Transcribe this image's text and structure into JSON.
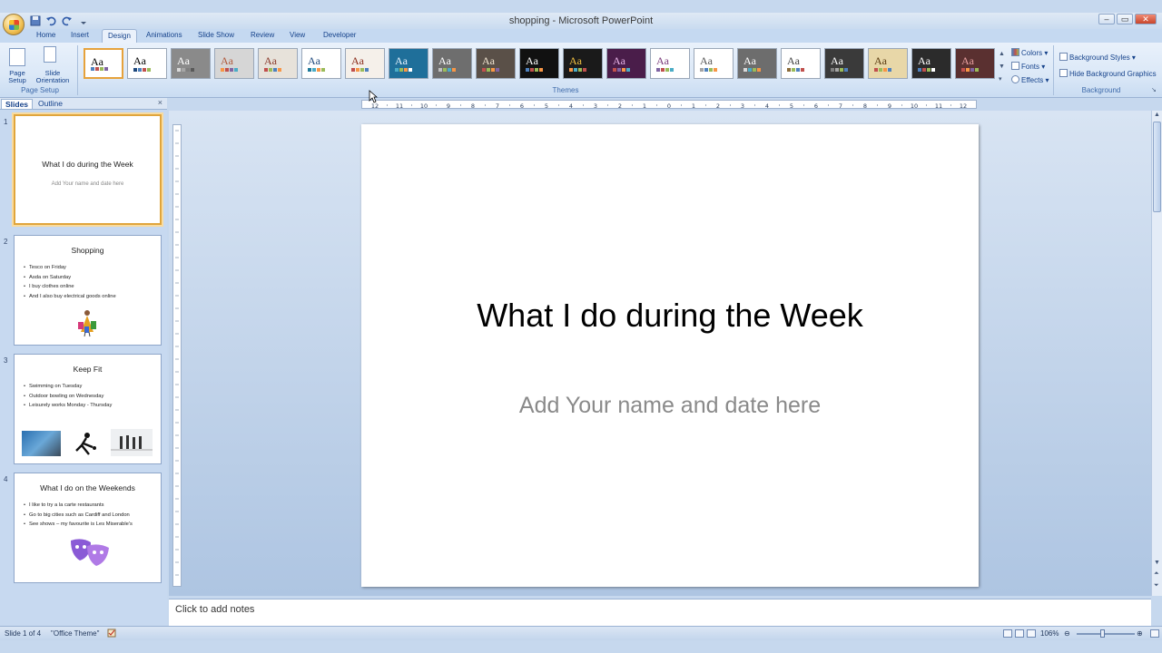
{
  "window": {
    "title": "shopping - Microsoft PowerPoint",
    "controls": [
      "–",
      "▭",
      "✕"
    ]
  },
  "tabs": [
    {
      "label": "Home"
    },
    {
      "label": "Insert"
    },
    {
      "label": "Design",
      "active": true
    },
    {
      "label": "Animations"
    },
    {
      "label": "Slide Show"
    },
    {
      "label": "Review"
    },
    {
      "label": "View"
    },
    {
      "label": "Developer"
    }
  ],
  "ribbon": {
    "page_setup": {
      "page_setup_label": "Page Setup",
      "slide_orientation_label": "Slide Orientation",
      "group_label": "Page Setup"
    },
    "themes": {
      "group_label": "Themes",
      "sample_text": "Aa",
      "items": [
        {
          "bg": "#ffffff",
          "fg": "#000000",
          "bars": [
            "#4f81bd",
            "#c0504d",
            "#9bbb59",
            "#8064a2"
          ],
          "selected": true
        },
        {
          "bg": "#ffffff",
          "fg": "#000000",
          "bars": [
            "#1f497d",
            "#4f81bd",
            "#c0504d",
            "#9bbb59"
          ]
        },
        {
          "bg": "#8a8a8a",
          "fg": "#ffffff",
          "bars": [
            "#d9d9d9",
            "#a5a5a5",
            "#7f7f7f",
            "#595959"
          ]
        },
        {
          "bg": "#d6d6d6",
          "fg": "#b05a3c",
          "bars": [
            "#f79646",
            "#c0504d",
            "#8064a2",
            "#4bacc6"
          ]
        },
        {
          "bg": "#e7e2da",
          "fg": "#8a3b2c",
          "bars": [
            "#c0504d",
            "#9bbb59",
            "#4f81bd",
            "#f79646"
          ]
        },
        {
          "bg": "#ffffff",
          "fg": "#1f497d",
          "bars": [
            "#1f7a9a",
            "#4bacc6",
            "#f79646",
            "#9bbb59"
          ]
        },
        {
          "bg": "#f5f0ea",
          "fg": "#8a2b1a",
          "bars": [
            "#c0504d",
            "#f79646",
            "#9bbb59",
            "#4f81bd"
          ]
        },
        {
          "bg": "#1f6f9a",
          "fg": "#e8f4ff",
          "bars": [
            "#4bacc6",
            "#9bbb59",
            "#f79646",
            "#ffffff"
          ]
        },
        {
          "bg": "#6e6e6e",
          "fg": "#ffffff",
          "bars": [
            "#c0c0c0",
            "#9bbb59",
            "#4bacc6",
            "#f79646"
          ]
        },
        {
          "bg": "#5a5048",
          "fg": "#f0e4d0",
          "bars": [
            "#c0504d",
            "#9bbb59",
            "#f79646",
            "#8064a2"
          ]
        },
        {
          "bg": "#111111",
          "fg": "#ffffff",
          "bars": [
            "#4f81bd",
            "#c0504d",
            "#9bbb59",
            "#f79646"
          ]
        },
        {
          "bg": "#1a1a1a",
          "fg": "#f0c040",
          "bars": [
            "#f79646",
            "#4bacc6",
            "#9bbb59",
            "#c0504d"
          ]
        },
        {
          "bg": "#4a1d4a",
          "fg": "#e6b3e6",
          "bars": [
            "#c0504d",
            "#8064a2",
            "#f79646",
            "#4bacc6"
          ]
        },
        {
          "bg": "#ffffff",
          "fg": "#7a3b7a",
          "bars": [
            "#8064a2",
            "#c0504d",
            "#9bbb59",
            "#4bacc6"
          ]
        },
        {
          "bg": "#ffffff",
          "fg": "#555555",
          "bars": [
            "#a5a5a5",
            "#4f81bd",
            "#9bbb59",
            "#f79646"
          ]
        },
        {
          "bg": "#6d6d6d",
          "fg": "#ffffff",
          "bars": [
            "#d9d9d9",
            "#4bacc6",
            "#9bbb59",
            "#f79646"
          ]
        },
        {
          "bg": "#ffffff",
          "fg": "#444444",
          "bars": [
            "#8c6c3b",
            "#9bbb59",
            "#4f81bd",
            "#c0504d"
          ]
        },
        {
          "bg": "#3a3a3a",
          "fg": "#ffffff",
          "bars": [
            "#7f7f7f",
            "#a5a5a5",
            "#9bbb59",
            "#4f81bd"
          ]
        },
        {
          "bg": "#e8d7a8",
          "fg": "#5a3b10",
          "bars": [
            "#c0504d",
            "#9bbb59",
            "#f79646",
            "#4f81bd"
          ]
        },
        {
          "bg": "#2b2b2b",
          "fg": "#ffffff",
          "bars": [
            "#4f81bd",
            "#c0504d",
            "#9bbb59",
            "#ffffff"
          ]
        },
        {
          "bg": "#5a3030",
          "fg": "#e8a0a0",
          "bars": [
            "#c0504d",
            "#f79646",
            "#8064a2",
            "#9bbb59"
          ]
        }
      ]
    },
    "theme_options": {
      "colors": "Colors",
      "fonts": "Fonts",
      "effects": "Effects"
    },
    "background": {
      "styles": "Background Styles",
      "hide": "Hide Background Graphics",
      "group_label": "Background"
    }
  },
  "pane": {
    "tab_slides": "Slides",
    "tab_outline": "Outline",
    "close": "×"
  },
  "slides": [
    {
      "number": "1",
      "title": "What I do during the Week",
      "subtitle": "Add Your name and date here",
      "bullets": []
    },
    {
      "number": "2",
      "title": "Shopping",
      "bullets": [
        "Tesco on Friday",
        "Asda on Saturday",
        "I buy clothes online",
        "And I also buy electrical goods online"
      ]
    },
    {
      "number": "3",
      "title": "Keep Fit",
      "bullets": [
        "Swimming on Tuesday",
        "Outdoor bowling on Wednesday",
        "Leisurely works Monday - Thursday"
      ]
    },
    {
      "number": "4",
      "title": "What I do on the Weekends",
      "bullets": [
        "I like to try a la carte restaurants",
        "Go to big cities such as Cardiff and London",
        "See shows – my favourite is Les Miserable's"
      ]
    }
  ],
  "main_slide": {
    "title": "What I do during the Week",
    "subtitle": "Add Your name and date here"
  },
  "ruler": {
    "h_labels": [
      "12",
      "11",
      "10",
      "9",
      "8",
      "7",
      "6",
      "5",
      "4",
      "3",
      "2",
      "1",
      "0",
      "1",
      "2",
      "3",
      "4",
      "5",
      "6",
      "7",
      "8",
      "9",
      "10",
      "11",
      "12"
    ]
  },
  "notes": {
    "placeholder": "Click to add notes"
  },
  "status": {
    "slide_info": "Slide 1 of 4",
    "theme_name": "\"Office Theme\"",
    "zoom": "106%"
  }
}
